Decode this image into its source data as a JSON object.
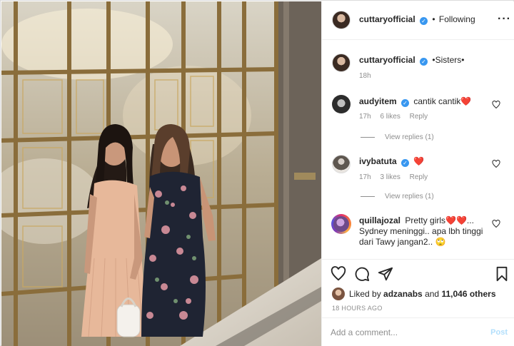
{
  "header": {
    "username": "cuttaryofficial",
    "separator": "•",
    "follow_status": "Following",
    "more_icon": "more-horizontal-icon"
  },
  "caption": {
    "username": "cuttaryofficial",
    "text": "•Sisters•",
    "time": "18h"
  },
  "comments": [
    {
      "username": "audyitem",
      "verified": true,
      "text": "cantik cantik❤️",
      "time": "17h",
      "likes": "6 likes",
      "reply_label": "Reply",
      "view_replies": "View replies (1)"
    },
    {
      "username": "ivybatuta",
      "verified": true,
      "text": "❤️",
      "time": "17h",
      "likes": "3 likes",
      "reply_label": "Reply",
      "view_replies": "View replies (1)"
    },
    {
      "username": "quillajozal",
      "verified": false,
      "text_line1": "Pretty girls❤️❤️...",
      "text_line2": "Sydney meninggi.. apa lbh tinggi",
      "text_line3": "dari Tawy jangan2.. 🙄"
    }
  ],
  "actions": {
    "icons": [
      "heart-icon",
      "comment-icon",
      "share-icon",
      "bookmark-icon"
    ],
    "liked_by_prefix": "Liked by",
    "liked_by_user": "adzanabs",
    "liked_by_and": "and",
    "liked_by_others": "11,046 others",
    "timestamp": "18 HOURS AGO"
  },
  "add_comment": {
    "placeholder": "Add a comment...",
    "post_label": "Post"
  },
  "colors": {
    "verified": "#3897f0",
    "post_disabled": "#b2dffc",
    "muted": "#8e8e8e"
  }
}
